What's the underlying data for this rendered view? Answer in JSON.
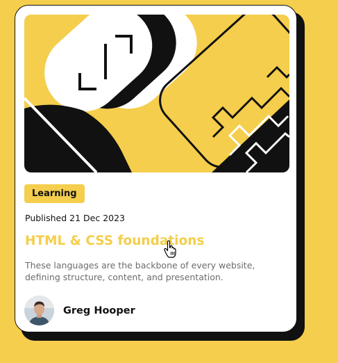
{
  "card": {
    "category": "Learning",
    "published": "Published 21 Dec 2023",
    "title": "HTML & CSS foundations",
    "description": "These languages are the backbone of every website, defining structure, content, and presentation.",
    "author": {
      "name": "Greg Hooper"
    },
    "hero_icon": "abstract-illustration",
    "avatar_icon": "person-avatar"
  },
  "colors": {
    "page_background": "#F4CE4C",
    "accent": "#F4CE4C",
    "text_dark": "#111111",
    "text_muted": "#6B6B6B",
    "card_background": "#FFFFFF"
  },
  "cursor": "hand-pointer-icon"
}
